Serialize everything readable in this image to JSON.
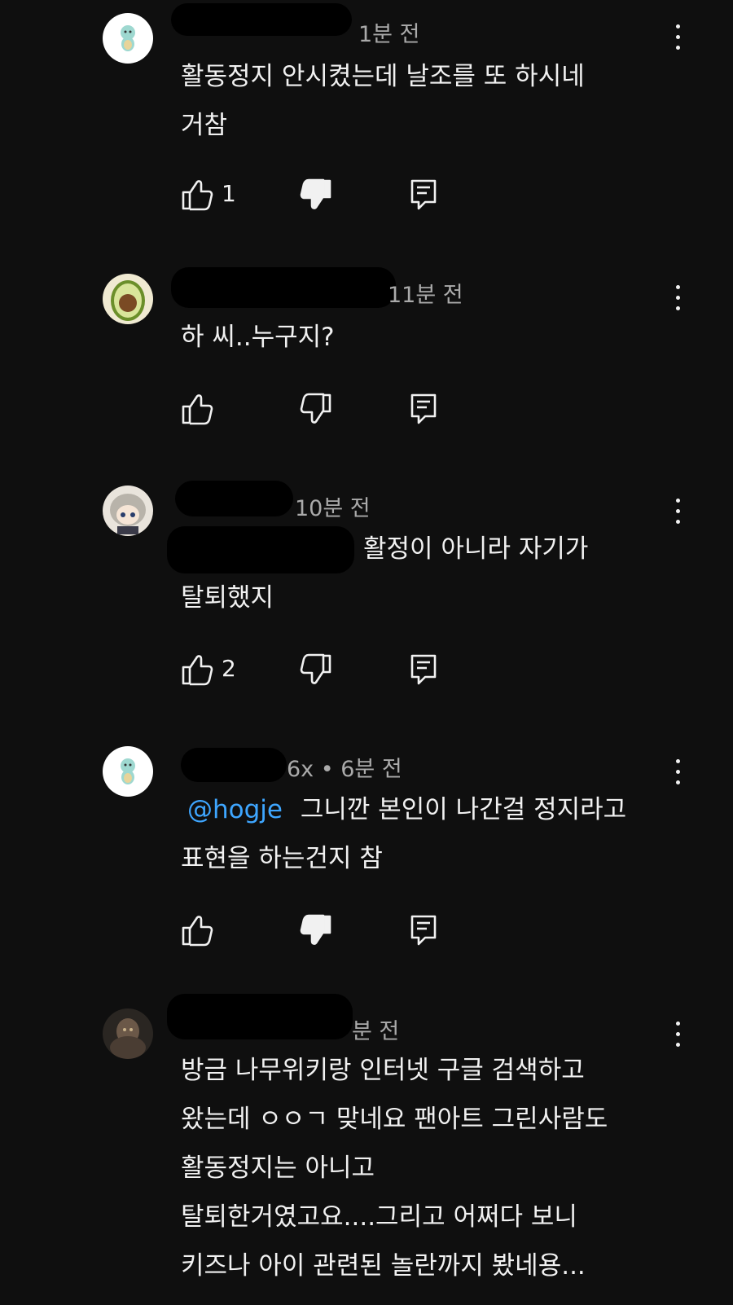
{
  "comments": [
    {
      "time": "1분 전",
      "lines": [
        "활동정지 안시켰는데 날조를 또 하시네",
        "거참"
      ],
      "like_count": "1",
      "disliked": true,
      "avatar": "squirtle-avatar"
    },
    {
      "time": "11분 전",
      "lines": [
        "하 씨..누구지?"
      ],
      "like_count": "",
      "disliked": false,
      "avatar": "avocado-avatar"
    },
    {
      "time": "10분 전",
      "lines": [
        "활정이 아니라 자기가",
        "탈퇴했지"
      ],
      "like_count": "2",
      "disliked": false,
      "avatar": "anime-girl-avatar"
    },
    {
      "time": "6x • 6분 전",
      "mention": "@hogje",
      "lines": [
        "그니깐 본인이 나간걸 정지라고",
        "표현을 하는건지 참"
      ],
      "like_count": "",
      "disliked": true,
      "avatar": "squirtle-avatar"
    },
    {
      "time": "분 전",
      "lines": [
        "방금 나무위키랑 인터넷 구글 검색하고",
        "왔는데 ㅇㅇㄱ 맞네요 팬아트 그린사람도",
        "활동정지는 아니고",
        "탈퇴한거였고요....그리고 어쩌다 보니",
        "키즈나 아이 관련된 놀란까지 봤네용..."
      ],
      "like_count": "",
      "disliked": false,
      "avatar": "dark-character-avatar"
    }
  ],
  "icons": {
    "like": "thumbs-up-icon",
    "dislike": "thumbs-down-icon",
    "reply": "reply-comment-icon",
    "more": "more-vertical-icon"
  },
  "colors": {
    "background": "#0f0f0f",
    "text": "#f1f1f1",
    "meta": "#aaaaaa",
    "mention": "#3ea6ff"
  }
}
